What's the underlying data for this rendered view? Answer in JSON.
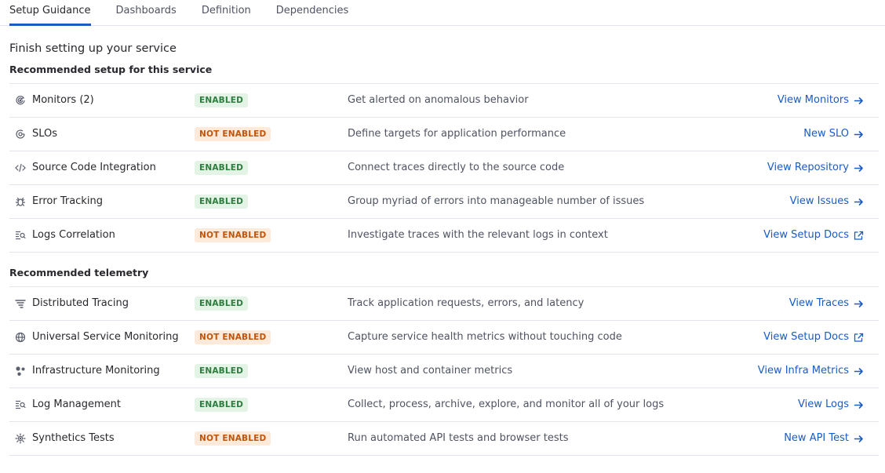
{
  "tabs": [
    {
      "label": "Setup Guidance"
    },
    {
      "label": "Dashboards"
    },
    {
      "label": "Definition"
    },
    {
      "label": "Dependencies"
    }
  ],
  "page_title": "Finish setting up your service",
  "sections": [
    {
      "title": "Recommended setup for this service",
      "rows": [
        {
          "icon": "monitor-icon",
          "name": "Monitors (2)",
          "status": "ENABLED",
          "description": "Get alerted on anomalous behavior",
          "action": "View Monitors",
          "action_icon": "arrow-right-icon"
        },
        {
          "icon": "slo-icon",
          "name": "SLOs",
          "status": "NOT ENABLED",
          "description": "Define targets for application performance",
          "action": "New SLO",
          "action_icon": "arrow-right-icon"
        },
        {
          "icon": "code-icon",
          "name": "Source Code Integration",
          "status": "ENABLED",
          "description": "Connect traces directly to the source code",
          "action": "View Repository",
          "action_icon": "arrow-right-icon"
        },
        {
          "icon": "bug-icon",
          "name": "Error Tracking",
          "status": "ENABLED",
          "description": "Group myriad of errors into manageable number of issues",
          "action": "View Issues",
          "action_icon": "arrow-right-icon"
        },
        {
          "icon": "logs-icon",
          "name": "Logs Correlation",
          "status": "NOT ENABLED",
          "description": "Investigate traces with the relevant logs in context",
          "action": "View Setup Docs",
          "action_icon": "external-link-icon"
        }
      ]
    },
    {
      "title": "Recommended telemetry",
      "rows": [
        {
          "icon": "tracing-icon",
          "name": "Distributed Tracing",
          "status": "ENABLED",
          "description": "Track application requests, errors, and latency",
          "action": "View Traces",
          "action_icon": "arrow-right-icon"
        },
        {
          "icon": "globe-icon",
          "name": "Universal Service Monitoring",
          "status": "NOT ENABLED",
          "description": "Capture service health metrics without touching code",
          "action": "View Setup Docs",
          "action_icon": "external-link-icon"
        },
        {
          "icon": "infra-icon",
          "name": "Infrastructure Monitoring",
          "status": "ENABLED",
          "description": "View host and container metrics",
          "action": "View Infra Metrics",
          "action_icon": "arrow-right-icon"
        },
        {
          "icon": "logs-icon",
          "name": "Log Management",
          "status": "ENABLED",
          "description": "Collect, process, archive, explore, and monitor all of your logs",
          "action": "View Logs",
          "action_icon": "arrow-right-icon"
        },
        {
          "icon": "synthetics-icon",
          "name": "Synthetics Tests",
          "status": "NOT ENABLED",
          "description": "Run automated API tests and browser tests",
          "action": "New API Test",
          "action_icon": "arrow-right-icon"
        }
      ]
    }
  ],
  "colors": {
    "accent": "#1a5bc4",
    "enabled_text": "#2e7d3e",
    "enabled_bg": "#e3f3e6",
    "not_enabled_text": "#c2540a",
    "not_enabled_bg": "#fdeadb"
  }
}
